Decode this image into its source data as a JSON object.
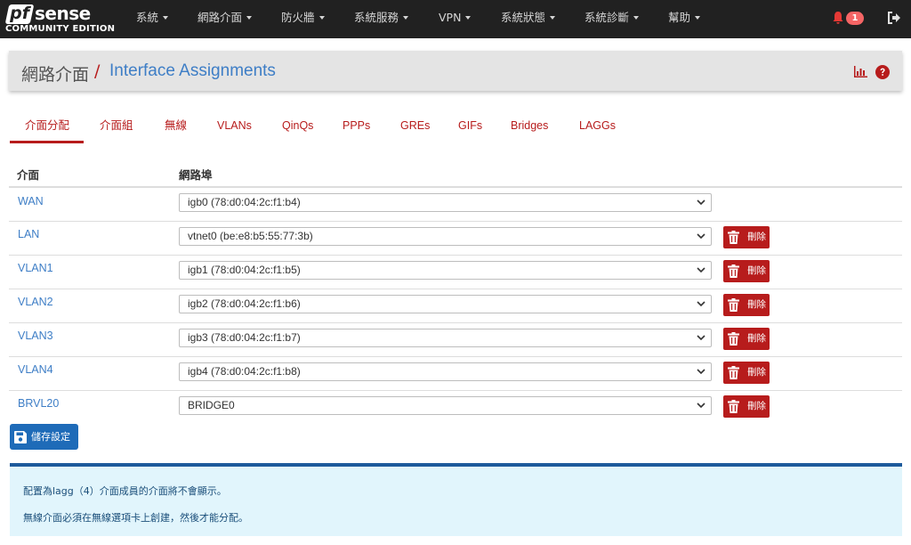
{
  "brand": {
    "logo_mark": "pf",
    "logo_word": "sense",
    "edition": "COMMUNITY EDITION"
  },
  "navbar": {
    "menus": [
      "系統",
      "網路介面",
      "防火牆",
      "系統服務",
      "VPN",
      "系統狀態",
      "系統診斷",
      "幫助"
    ],
    "notification_count": "1",
    "icons": {
      "notifications": "bell-icon",
      "logout": "logout-icon"
    }
  },
  "breadcrumb": {
    "root": "網路介面",
    "separator": "/",
    "current": "Interface Assignments",
    "icons": [
      "chart-icon",
      "help-icon"
    ]
  },
  "tabs": [
    {
      "label": "介面分配",
      "active": true
    },
    {
      "label": "介面組",
      "active": false
    },
    {
      "label": "無線",
      "active": false
    },
    {
      "label": "VLANs",
      "active": false
    },
    {
      "label": "QinQs",
      "active": false
    },
    {
      "label": "PPPs",
      "active": false
    },
    {
      "label": "GREs",
      "active": false
    },
    {
      "label": "GIFs",
      "active": false
    },
    {
      "label": "Bridges",
      "active": false
    },
    {
      "label": "LAGGs",
      "active": false
    }
  ],
  "table": {
    "headers": {
      "interface": "介面",
      "port": "網路埠"
    },
    "rows": [
      {
        "name": "WAN",
        "port": "igb0 (78:d0:04:2c:f1:b4)",
        "deletable": false
      },
      {
        "name": "LAN",
        "port": "vtnet0 (be:e8:b5:55:77:3b)",
        "deletable": true
      },
      {
        "name": "VLAN1",
        "port": "igb1 (78:d0:04:2c:f1:b5)",
        "deletable": true
      },
      {
        "name": "VLAN2",
        "port": "igb2 (78:d0:04:2c:f1:b6)",
        "deletable": true
      },
      {
        "name": "VLAN3",
        "port": "igb3 (78:d0:04:2c:f1:b7)",
        "deletable": true
      },
      {
        "name": "VLAN4",
        "port": "igb4 (78:d0:04:2c:f1:b8)",
        "deletable": true
      },
      {
        "name": "BRVL20",
        "port": "BRIDGE0",
        "deletable": true
      }
    ],
    "delete_label": "刪除"
  },
  "save_button": {
    "label": "儲存設定"
  },
  "info": {
    "lines": [
      "配置為lagg（4）介面成員的介面將不會顯示。",
      "無線介面必須在無線選項卡上創建，然後才能分配。"
    ]
  },
  "colors": {
    "navbar": "#212121",
    "accent_red": "#b71c1c",
    "link_blue": "#3e7ec6",
    "save_blue": "#1e6bb8",
    "info_bg": "#e1f5fc"
  }
}
